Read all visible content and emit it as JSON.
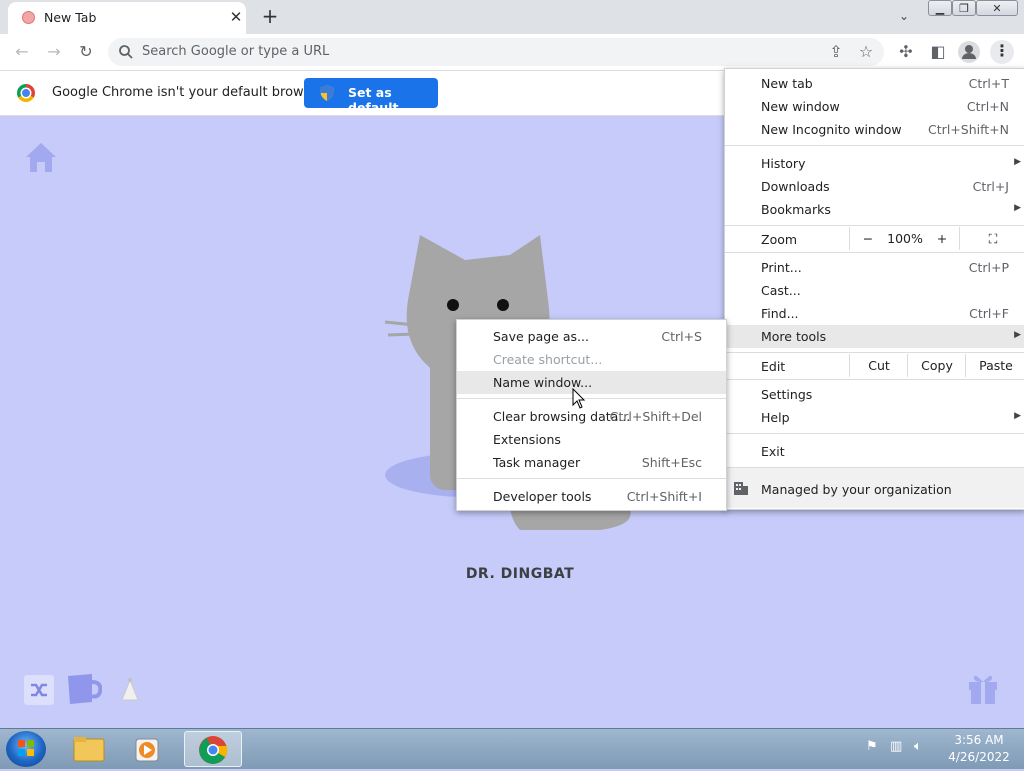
{
  "browser": {
    "tab": {
      "title": "New Tab"
    },
    "omnibox": {
      "placeholder": "Search Google or type a URL"
    },
    "infobar": {
      "message": "Google Chrome isn't your default browser",
      "button_label": "Set as default"
    }
  },
  "new_tab_page": {
    "doodle_label": "DR. DINGBAT",
    "background_color": "#c6cbfa"
  },
  "chrome_menu": {
    "items": [
      {
        "label": "New tab",
        "shortcut": "Ctrl+T"
      },
      {
        "label": "New window",
        "shortcut": "Ctrl+N"
      },
      {
        "label": "New Incognito window",
        "shortcut": "Ctrl+Shift+N"
      },
      {
        "label": "History",
        "submenu": true
      },
      {
        "label": "Downloads",
        "shortcut": "Ctrl+J"
      },
      {
        "label": "Bookmarks",
        "submenu": true
      },
      {
        "label": "Print...",
        "shortcut": "Ctrl+P"
      },
      {
        "label": "Cast..."
      },
      {
        "label": "Find...",
        "shortcut": "Ctrl+F"
      },
      {
        "label": "More tools",
        "submenu": true,
        "highlighted": true
      },
      {
        "label": "Settings"
      },
      {
        "label": "Help",
        "submenu": true
      },
      {
        "label": "Exit"
      }
    ],
    "zoom": {
      "label": "Zoom",
      "minus": "−",
      "value": "100%",
      "plus": "+"
    },
    "edit": {
      "label": "Edit",
      "cut": "Cut",
      "copy": "Copy",
      "paste": "Paste"
    },
    "managed": "Managed by your organization"
  },
  "more_tools_menu": {
    "items": [
      {
        "label": "Save page as...",
        "shortcut": "Ctrl+S"
      },
      {
        "label": "Create shortcut...",
        "disabled": true
      },
      {
        "label": "Name window...",
        "highlighted": true
      },
      {
        "label": "Clear browsing data...",
        "shortcut": "Ctrl+Shift+Del"
      },
      {
        "label": "Extensions"
      },
      {
        "label": "Task manager",
        "shortcut": "Shift+Esc"
      },
      {
        "label": "Developer tools",
        "shortcut": "Ctrl+Shift+I"
      }
    ]
  },
  "taskbar": {
    "time": "3:56 AM",
    "date": "4/26/2022"
  },
  "colors": {
    "accent": "#1a73e8",
    "ntp_background": "#c6cbfa",
    "menu_highlight": "#e8e8e9"
  }
}
